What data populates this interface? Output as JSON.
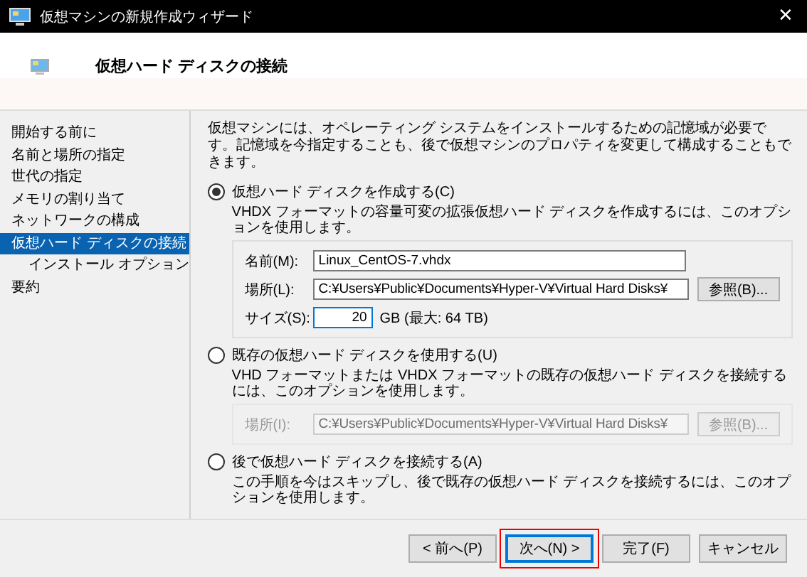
{
  "window": {
    "title": "仮想マシンの新規作成ウィザード",
    "close": "✕"
  },
  "header": {
    "title": "仮想ハード ディスクの接続"
  },
  "sidebar": {
    "items": [
      {
        "label": "開始する前に",
        "selected": false
      },
      {
        "label": "名前と場所の指定",
        "selected": false
      },
      {
        "label": "世代の指定",
        "selected": false
      },
      {
        "label": "メモリの割り当て",
        "selected": false
      },
      {
        "label": "ネットワークの構成",
        "selected": false
      },
      {
        "label": "仮想ハード ディスクの接続",
        "selected": true,
        "children": [
          {
            "label": "インストール オプション",
            "selected": false
          }
        ]
      },
      {
        "label": "要約",
        "selected": false
      }
    ]
  },
  "intro": "仮想マシンには、オペレーティング システムをインストールするための記憶域が必要です。記憶域を今指定することも、後で仮想マシンのプロパティを変更して構成することもできます。",
  "options": [
    {
      "label": "仮想ハード ディスクを作成する(C)",
      "selected": true,
      "description": "VHDX フォーマットの容量可変の拡張仮想ハード ディスクを作成するには、このオプションを使用します。",
      "group": {
        "disabled": false,
        "fields": [
          {
            "kind": "text",
            "label": "名前(M):",
            "value": "Linux_CentOS-7.vhdx"
          },
          {
            "kind": "browse",
            "label": "場所(L):",
            "value": "C:¥Users¥Public¥Documents¥Hyper-V¥Virtual Hard Disks¥",
            "button": "参照(B)..."
          },
          {
            "kind": "size",
            "label": "サイズ(S):",
            "value": "20",
            "suffix": "GB (最大: 64 TB)"
          }
        ]
      }
    },
    {
      "label": "既存の仮想ハード ディスクを使用する(U)",
      "selected": false,
      "description": "VHD フォーマットまたは VHDX フォーマットの既存の仮想ハード ディスクを接続するには、このオプションを使用します。",
      "group": {
        "disabled": true,
        "fields": [
          {
            "kind": "browse",
            "label": "場所(I):",
            "value": "C:¥Users¥Public¥Documents¥Hyper-V¥Virtual Hard Disks¥",
            "button": "参照(B)..."
          }
        ]
      }
    },
    {
      "label": "後で仮想ハード ディスクを接続する(A)",
      "selected": false,
      "description": "この手順を今はスキップし、後で既存の仮想ハード ディスクを接続するには、このオプションを使用します。"
    }
  ],
  "buttons": [
    {
      "label": "< 前へ(P)",
      "default": false,
      "highlighted": false
    },
    {
      "label": "次へ(N) >",
      "default": true,
      "highlighted": true
    },
    {
      "label": "完了(F)",
      "default": false,
      "highlighted": false
    },
    {
      "label": "キャンセル",
      "default": false,
      "highlighted": false
    }
  ]
}
